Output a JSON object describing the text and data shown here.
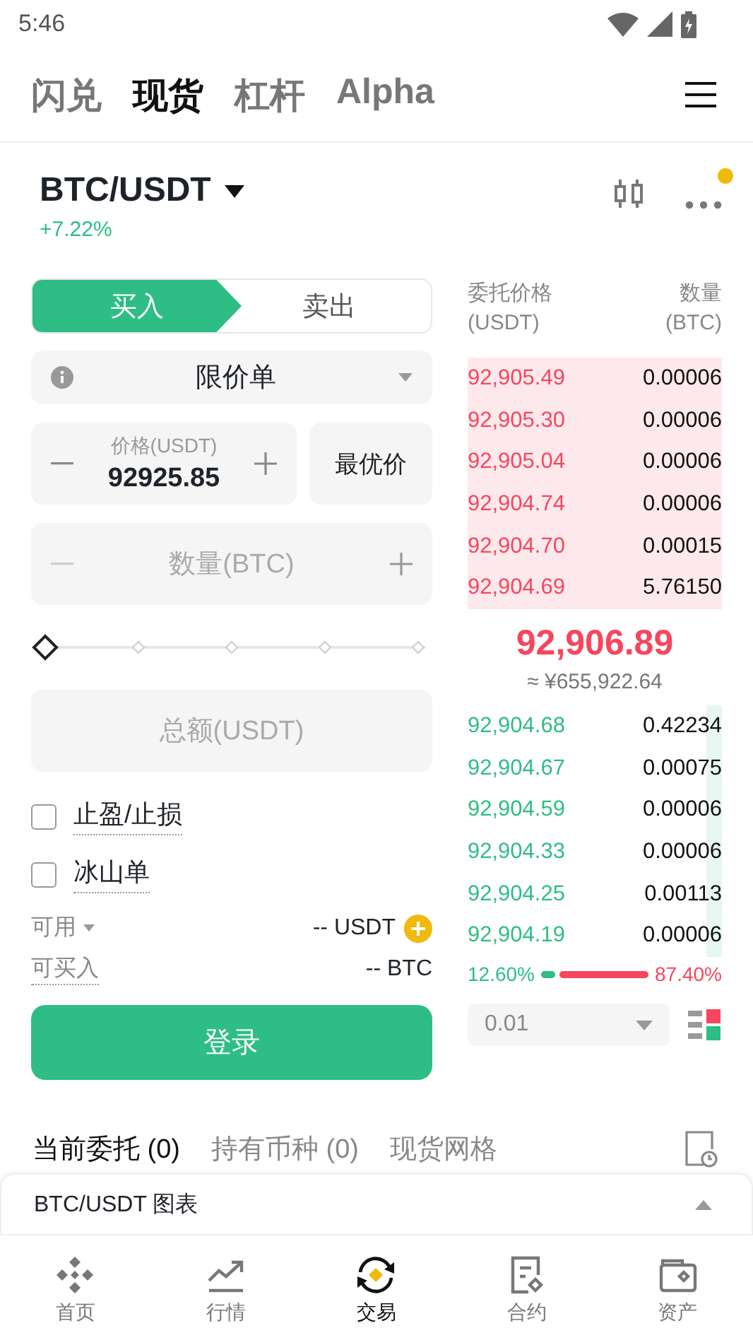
{
  "status_bar": {
    "time": "5:46"
  },
  "top_tabs": [
    {
      "label": "闪兑",
      "selected": false
    },
    {
      "label": "现货",
      "selected": true
    },
    {
      "label": "杠杆",
      "selected": false
    },
    {
      "label": "Alpha",
      "selected": false
    }
  ],
  "pair": {
    "symbol": "BTC/USDT",
    "change": "+7.22%"
  },
  "side_tabs": [
    {
      "label": "买入",
      "selected": true
    },
    {
      "label": "卖出",
      "selected": false
    }
  ],
  "order_type": "限价单",
  "price_field": {
    "label": "价格(USDT)",
    "value": "92925.85"
  },
  "best_price_button": "最优价",
  "quantity_field": {
    "placeholder": "数量(BTC)"
  },
  "slider": {
    "level": 0
  },
  "total_field": {
    "placeholder": "总额(USDT)"
  },
  "options": [
    {
      "label": "止盈/止损",
      "checked": false
    },
    {
      "label": "冰山单",
      "checked": false
    }
  ],
  "available": {
    "label": "可用",
    "value": "-- USDT"
  },
  "max_buy": {
    "label": "可买入",
    "value": "-- BTC"
  },
  "login_button": "登录",
  "order_book": {
    "price_header": "委托价格",
    "price_unit": "(USDT)",
    "qty_header": "数量",
    "qty_unit": "(BTC)",
    "asks": [
      {
        "price": "92,905.49",
        "amount": "0.00006"
      },
      {
        "price": "92,905.30",
        "amount": "0.00006"
      },
      {
        "price": "92,905.04",
        "amount": "0.00006"
      },
      {
        "price": "92,904.74",
        "amount": "0.00006"
      },
      {
        "price": "92,904.70",
        "amount": "0.00015"
      },
      {
        "price": "92,904.69",
        "amount": "5.76150"
      }
    ],
    "last_price": "92,906.89",
    "last_price_cny": "≈ ¥655,922.64",
    "bids": [
      {
        "price": "92,904.68",
        "amount": "0.42234"
      },
      {
        "price": "92,904.67",
        "amount": "0.00075"
      },
      {
        "price": "92,904.59",
        "amount": "0.00006"
      },
      {
        "price": "92,904.33",
        "amount": "0.00006"
      },
      {
        "price": "92,904.25",
        "amount": "0.00113"
      },
      {
        "price": "92,904.19",
        "amount": "0.00006"
      }
    ],
    "buy_ratio": "12.60%",
    "sell_ratio": "87.40%",
    "ratio_bar": {
      "level": 0.126
    },
    "precision": "0.01"
  },
  "order_tabs": [
    {
      "label": "当前委托 (0)",
      "selected": true
    },
    {
      "label": "持有币种 (0)",
      "selected": false
    },
    {
      "label": "现货网格",
      "selected": false
    }
  ],
  "chart_bar": {
    "label": "BTC/USDT 图表"
  },
  "nav": [
    {
      "label": "首页",
      "selected": false
    },
    {
      "label": "行情",
      "selected": false
    },
    {
      "label": "交易",
      "selected": true
    },
    {
      "label": "合约",
      "selected": false
    },
    {
      "label": "资产",
      "selected": false
    }
  ]
}
